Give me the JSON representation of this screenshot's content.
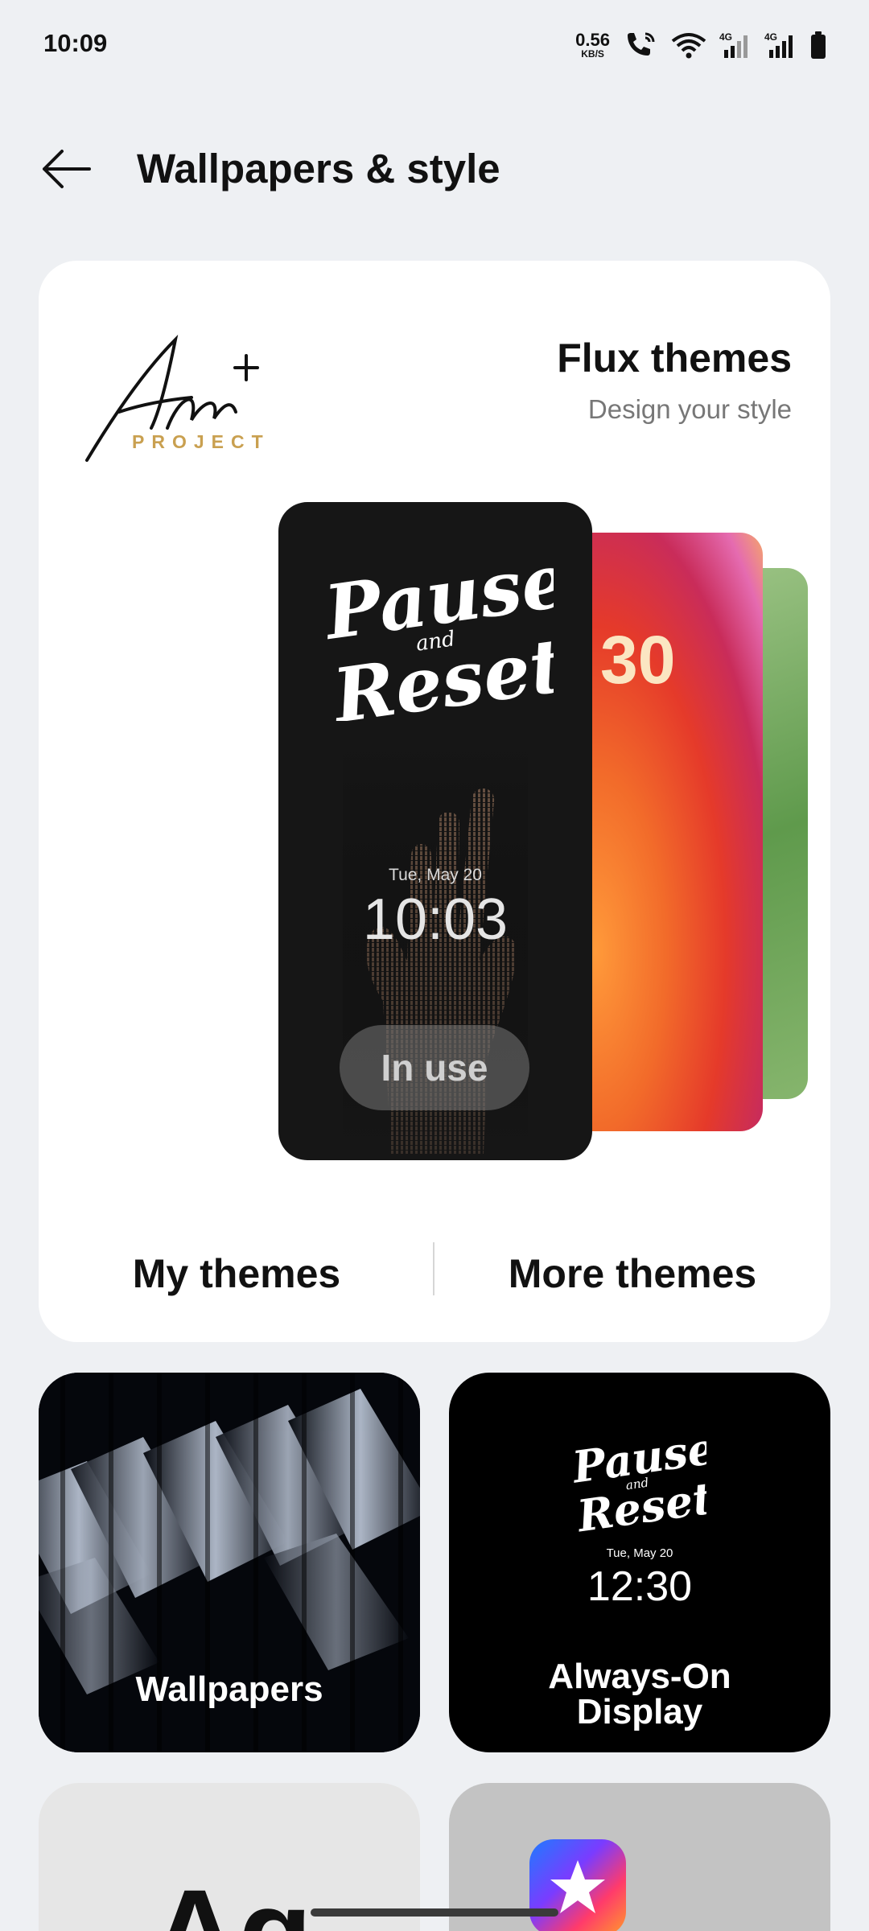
{
  "status_bar": {
    "time": "10:09",
    "net_speed_value": "0.56",
    "net_speed_unit": "KB/S",
    "icons": [
      "wifi-calling-icon",
      "wifi-icon",
      "signal-4g-icon",
      "signal-4g-icon",
      "battery-icon"
    ],
    "network_labels": [
      "4G",
      "4G"
    ]
  },
  "header": {
    "title": "Wallpapers & style",
    "back_icon": "arrow-left-icon"
  },
  "themes": {
    "brand_wordmark": "Art",
    "brand_sub": "PROJECT",
    "title": "Flux themes",
    "subtitle": "Design your style",
    "current_theme": {
      "art_text": "Pause and Reset",
      "date": "Tue, May 20",
      "time": "10:03",
      "status": "In use"
    },
    "peek_card_time": "30",
    "actions": {
      "my_themes": "My themes",
      "more_themes": "More themes"
    }
  },
  "tiles": {
    "wallpapers": {
      "label": "Wallpapers"
    },
    "aod": {
      "label_line1": "Always-On",
      "label_line2": "Display",
      "art_text": "Pause and Reset",
      "date": "Tue, May 20",
      "time": "12:30"
    },
    "fonts": {
      "sample": "Ag"
    },
    "icons": {
      "icon": "star-app-icon"
    }
  },
  "colors": {
    "background": "#eef0f3",
    "card": "#ffffff",
    "brand_accent": "#c9a050"
  }
}
